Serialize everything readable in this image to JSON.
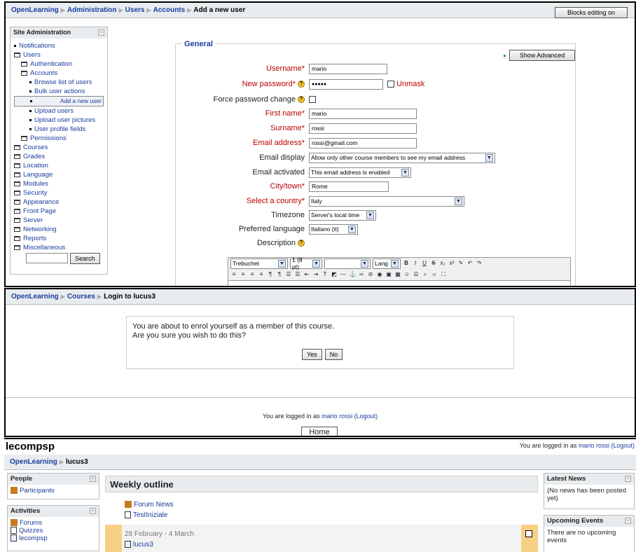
{
  "panel1": {
    "breadcrumb": [
      "OpenLearning",
      "Administration",
      "Users",
      "Accounts",
      "Add a new user"
    ],
    "blocks_button": "Blocks editing on",
    "sidebar": {
      "title": "Site Administration",
      "items": [
        {
          "label": "Notifications",
          "type": "bullet",
          "level": 0
        },
        {
          "label": "Users",
          "type": "folder-open",
          "level": 0
        },
        {
          "label": "Authentication",
          "type": "folder",
          "level": 1
        },
        {
          "label": "Accounts",
          "type": "folder-open",
          "level": 1
        },
        {
          "label": "Browse list of users",
          "type": "bullet",
          "level": 2
        },
        {
          "label": "Bulk user actions",
          "type": "bullet",
          "level": 2
        },
        {
          "label": "Add a new user",
          "type": "bullet",
          "level": 2,
          "selected": true
        },
        {
          "label": "Upload users",
          "type": "bullet",
          "level": 2
        },
        {
          "label": "Upload user pictures",
          "type": "bullet",
          "level": 2
        },
        {
          "label": "User profile fields",
          "type": "bullet",
          "level": 2
        },
        {
          "label": "Permissions",
          "type": "folder",
          "level": 1
        },
        {
          "label": "Courses",
          "type": "folder",
          "level": 0
        },
        {
          "label": "Grades",
          "type": "folder",
          "level": 0
        },
        {
          "label": "Location",
          "type": "folder",
          "level": 0
        },
        {
          "label": "Language",
          "type": "folder",
          "level": 0
        },
        {
          "label": "Modules",
          "type": "folder",
          "level": 0
        },
        {
          "label": "Security",
          "type": "folder",
          "level": 0
        },
        {
          "label": "Appearance",
          "type": "folder",
          "level": 0
        },
        {
          "label": "Front Page",
          "type": "folder",
          "level": 0
        },
        {
          "label": "Server",
          "type": "folder",
          "level": 0
        },
        {
          "label": "Networking",
          "type": "folder",
          "level": 0
        },
        {
          "label": "Reports",
          "type": "folder",
          "level": 0
        },
        {
          "label": "Miscellaneous",
          "type": "folder",
          "level": 0
        }
      ],
      "search_button": "Search",
      "search_value": ""
    },
    "form": {
      "legend": "General",
      "show_advanced": "Show Advanced",
      "username_label": "Username*",
      "username_value": "mario",
      "password_label": "New password*",
      "password_value": "●●●●●",
      "unmask_label": "Unmask",
      "force_label": "Force password change",
      "firstname_label": "First name*",
      "firstname_value": "mario",
      "surname_label": "Surname*",
      "surname_value": "rossi",
      "email_label": "Email address*",
      "email_value": "rossi@gmail.com",
      "email_display_label": "Email display",
      "email_display_value": "Allow only other course members to see my email address",
      "email_activated_label": "Email activated",
      "email_activated_value": "This email address is enabled",
      "city_label": "City/town*",
      "city_value": "Rome",
      "country_label": "Select a country*",
      "country_value": "Italy",
      "timezone_label": "Timezone",
      "timezone_value": "Server's local time",
      "language_label": "Preferred language",
      "language_value": "Italiano (it)",
      "description_label": "Description",
      "editor": {
        "font": "Trebuchet",
        "size": "1 (8 pt)",
        "lang": "Lang"
      }
    }
  },
  "panel2": {
    "breadcrumb": [
      "OpenLearning",
      "Courses",
      "Login to lucus3"
    ],
    "message_line1": "You are about to enrol yourself as a member of this course.",
    "message_line2": "Are you sure you wish to do this?",
    "yes_button": "Yes",
    "no_button": "No",
    "logged_in_prefix": "You are logged in as",
    "logged_in_user": "mario rossi",
    "logout": "(Logout)",
    "home": "Home"
  },
  "panel3": {
    "site_name": "lecompsp",
    "logged_in_prefix": "You are logged in as",
    "logged_in_user": "mario rossi",
    "logout": "(Logout)",
    "breadcrumb": [
      "OpenLearning",
      "lucus3"
    ],
    "people": {
      "title": "People",
      "items": [
        "Participants"
      ]
    },
    "activities": {
      "title": "Activities",
      "items": [
        "Forums",
        "Quizzes",
        "lecompsp"
      ]
    },
    "weekly_title": "Weekly outline",
    "week0_items": [
      "Forum News",
      "TestIniziale"
    ],
    "week1_date": "28 February - 4 March",
    "week1_items": [
      "lucus3"
    ],
    "latest_news": {
      "title": "Latest News",
      "text": "(No news has been posted yet)"
    },
    "upcoming": {
      "title": "Upcoming Events",
      "text": "There are no upcoming events"
    }
  }
}
